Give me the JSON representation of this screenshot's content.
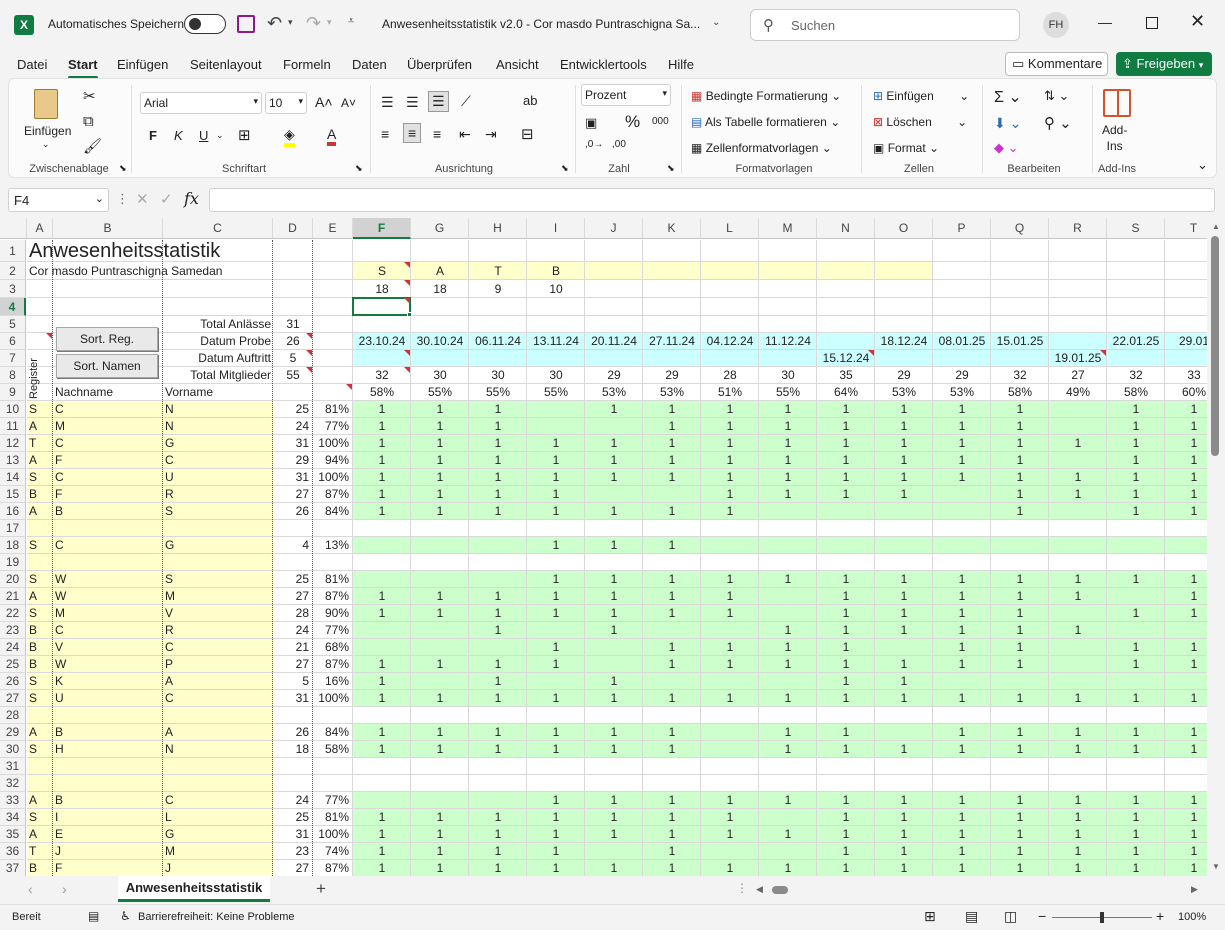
{
  "titlebar": {
    "autosave_label": "Automatisches Speichern",
    "title": "Anwesenheitsstatistik v2.0 - Cor masdo Puntraschigna Sa...",
    "search_placeholder": "Suchen",
    "avatar": "FH"
  },
  "tabs": [
    "Datei",
    "Start",
    "Einfügen",
    "Seitenlayout",
    "Formeln",
    "Daten",
    "Überprüfen",
    "Ansicht",
    "Entwicklertools",
    "Hilfe"
  ],
  "comments_label": "Kommentare",
  "share_label": "Freigeben",
  "ribbon": {
    "paste": "Einfügen",
    "clipboard": "Zwischenablage",
    "font_name": "Arial",
    "font_size": "10",
    "font": "Schriftart",
    "bold": "F",
    "italic": "K",
    "underline": "U",
    "align": "Ausrichtung",
    "numfmt": "Prozent",
    "number": "Zahl",
    "cond": "Bedingte Formatierung",
    "astable": "Als Tabelle formatieren",
    "cellstyles": "Zellenformatvorlagen",
    "styles": "Formatvorlagen",
    "insert": "Einfügen",
    "delete": "Löschen",
    "format": "Format",
    "cells": "Zellen",
    "edit": "Bearbeiten",
    "addins": "Add-\nIns",
    "addins_group": "Add-Ins"
  },
  "namebox": "F4",
  "columns": [
    "A",
    "B",
    "C",
    "D",
    "E",
    "F",
    "G",
    "H",
    "I",
    "J",
    "K",
    "L",
    "M",
    "N",
    "O",
    "P",
    "Q",
    "R",
    "S",
    "T"
  ],
  "rows": [
    "1",
    "2",
    "3",
    "4",
    "5",
    "6",
    "7",
    "8",
    "9",
    "10",
    "11",
    "12",
    "13",
    "14",
    "15",
    "16",
    "17",
    "18",
    "19",
    "20",
    "21",
    "22",
    "23",
    "24",
    "25",
    "26",
    "27",
    "28",
    "29",
    "30",
    "31",
    "32",
    "33",
    "34",
    "35",
    "36",
    "37"
  ],
  "sheet": {
    "title": "Anwesenheitsstatistik",
    "subtitle": "Cor masdo Puntraschigna Samedan",
    "registers": [
      "S",
      "A",
      "T",
      "B"
    ],
    "register_counts": [
      "18",
      "18",
      "9",
      "10"
    ],
    "btn_reg": "Sort. Reg.",
    "btn_names": "Sort. Namen",
    "lbl_total": "Total Anlässe",
    "val_total": "31",
    "lbl_probe": "Datum Probe",
    "val_probe": "26",
    "lbl_auftritt": "Datum Auftritt",
    "val_auftritt": "5",
    "lbl_members": "Total Mitglieder",
    "val_members": "55",
    "vert_register": "Register",
    "hdr_nachname": "Nachname",
    "hdr_vorname": "Vorname",
    "probe_dates": [
      "23.10.24",
      "30.10.24",
      "06.11.24",
      "13.11.24",
      "20.11.24",
      "27.11.24",
      "04.12.24",
      "11.12.24",
      "",
      "18.12.24",
      "08.01.25",
      "15.01.25",
      "",
      "22.01.25",
      "29.01"
    ],
    "auftritt_dates": [
      "",
      "",
      "",
      "",
      "",
      "",
      "",
      "",
      "15.12.24",
      "",
      "",
      "",
      "19.01.25",
      "",
      ""
    ],
    "counts": [
      "32",
      "30",
      "30",
      "30",
      "29",
      "29",
      "28",
      "30",
      "35",
      "29",
      "29",
      "32",
      "27",
      "32",
      "33"
    ],
    "pcts": [
      "58%",
      "55%",
      "55%",
      "55%",
      "53%",
      "53%",
      "51%",
      "55%",
      "64%",
      "53%",
      "53%",
      "58%",
      "49%",
      "58%",
      "60%"
    ],
    "people": [
      {
        "row": "10",
        "reg": "S",
        "last": "C",
        "first": "N",
        "n": "25",
        "p": "81%",
        "a": "111011111111011"
      },
      {
        "row": "11",
        "reg": "A",
        "last": "M",
        "first": "N",
        "n": "24",
        "p": "77%",
        "a": "111001111111011"
      },
      {
        "row": "12",
        "reg": "T",
        "last": "C",
        "first": "G",
        "n": "31",
        "p": "100%",
        "a": "111111111111111"
      },
      {
        "row": "13",
        "reg": "A",
        "last": "F",
        "first": "C",
        "n": "29",
        "p": "94%",
        "a": "111111111111011"
      },
      {
        "row": "14",
        "reg": "S",
        "last": "C",
        "first": "U",
        "n": "31",
        "p": "100%",
        "a": "111111111111111"
      },
      {
        "row": "15",
        "reg": "B",
        "last": "F",
        "first": "R",
        "n": "27",
        "p": "87%",
        "a": "111100111101111"
      },
      {
        "row": "16",
        "reg": "A",
        "last": "B",
        "first": "S",
        "n": "26",
        "p": "84%",
        "a": "111111100001011"
      },
      {
        "row": "17",
        "reg": "",
        "last": "",
        "first": "",
        "n": "",
        "p": "",
        "a": ""
      },
      {
        "row": "18",
        "reg": "S",
        "last": "C",
        "first": "G",
        "n": "4",
        "p": "13%",
        "a": "000111000000000"
      },
      {
        "row": "19",
        "reg": "",
        "last": "",
        "first": "",
        "n": "",
        "p": "",
        "a": ""
      },
      {
        "row": "20",
        "reg": "S",
        "last": "W",
        "first": "S",
        "n": "25",
        "p": "81%",
        "a": "000111111111111"
      },
      {
        "row": "21",
        "reg": "A",
        "last": "W",
        "first": "M",
        "n": "27",
        "p": "87%",
        "a": "111111101111101"
      },
      {
        "row": "22",
        "reg": "S",
        "last": "M",
        "first": "V",
        "n": "28",
        "p": "90%",
        "a": "111111101111011"
      },
      {
        "row": "23",
        "reg": "B",
        "last": "C",
        "first": "R",
        "n": "24",
        "p": "77%",
        "a": "001010011111100"
      },
      {
        "row": "24",
        "reg": "B",
        "last": "V",
        "first": "C",
        "n": "21",
        "p": "68%",
        "a": "000101111011011"
      },
      {
        "row": "25",
        "reg": "B",
        "last": "W",
        "first": "P",
        "n": "27",
        "p": "87%",
        "a": "111101111111011"
      },
      {
        "row": "26",
        "reg": "S",
        "last": "K",
        "first": "A",
        "n": "5",
        "p": "16%",
        "a": "101010001100000"
      },
      {
        "row": "27",
        "reg": "S",
        "last": "U",
        "first": "C",
        "n": "31",
        "p": "100%",
        "a": "111111111111111"
      },
      {
        "row": "28",
        "reg": "",
        "last": "",
        "first": "",
        "n": "",
        "p": "",
        "a": ""
      },
      {
        "row": "29",
        "reg": "A",
        "last": "B",
        "first": "A",
        "n": "26",
        "p": "84%",
        "a": "111111011011111"
      },
      {
        "row": "30",
        "reg": "S",
        "last": "H",
        "first": "N",
        "n": "18",
        "p": "58%",
        "a": "111111011111111"
      },
      {
        "row": "31",
        "reg": "",
        "last": "",
        "first": "",
        "n": "",
        "p": "",
        "a": ""
      },
      {
        "row": "32",
        "reg": "",
        "last": "",
        "first": "",
        "n": "",
        "p": "",
        "a": ""
      },
      {
        "row": "33",
        "reg": "A",
        "last": "B",
        "first": "C",
        "n": "24",
        "p": "77%",
        "a": "000111111111111"
      },
      {
        "row": "34",
        "reg": "S",
        "last": "I",
        "first": "L",
        "n": "25",
        "p": "81%",
        "a": "111111101111111"
      },
      {
        "row": "35",
        "reg": "A",
        "last": "E",
        "first": "G",
        "n": "31",
        "p": "100%",
        "a": "111111111111111"
      },
      {
        "row": "36",
        "reg": "T",
        "last": "J",
        "first": "M",
        "n": "23",
        "p": "74%",
        "a": "111101001111111"
      },
      {
        "row": "37",
        "reg": "B",
        "last": "F",
        "first": "J",
        "n": "27",
        "p": "87%",
        "a": "111111111111111"
      }
    ]
  },
  "sheet_tab": "Anwesenheitsstatistik",
  "status": {
    "ready": "Bereit",
    "access": "Barrierefreiheit: Keine Probleme",
    "zoom": "100%"
  },
  "colors": {
    "yellow": "#ffffcc",
    "green": "#ccffcc",
    "cyan": "#ccffff",
    "excel_green": "#107c41"
  }
}
